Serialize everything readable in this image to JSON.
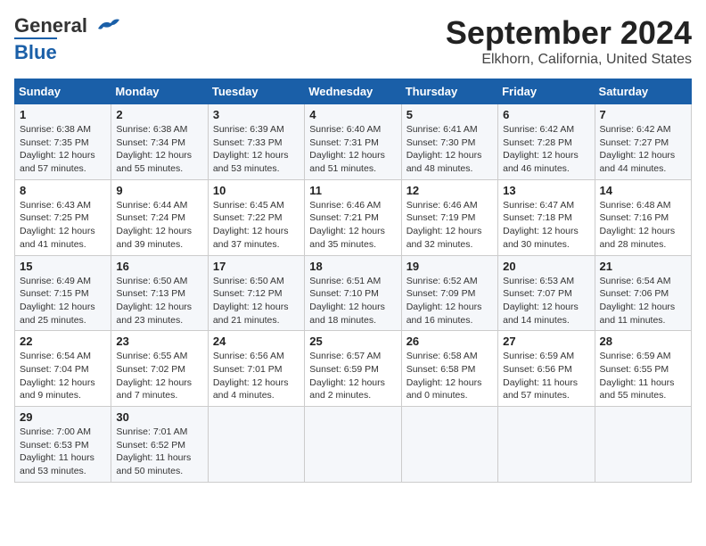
{
  "header": {
    "logo_line1": "General",
    "logo_line2": "Blue",
    "main_title": "September 2024",
    "subtitle": "Elkhorn, California, United States"
  },
  "weekdays": [
    "Sunday",
    "Monday",
    "Tuesday",
    "Wednesday",
    "Thursday",
    "Friday",
    "Saturday"
  ],
  "weeks": [
    [
      {
        "day": "1",
        "detail": "Sunrise: 6:38 AM\nSunset: 7:35 PM\nDaylight: 12 hours\nand 57 minutes."
      },
      {
        "day": "2",
        "detail": "Sunrise: 6:38 AM\nSunset: 7:34 PM\nDaylight: 12 hours\nand 55 minutes."
      },
      {
        "day": "3",
        "detail": "Sunrise: 6:39 AM\nSunset: 7:33 PM\nDaylight: 12 hours\nand 53 minutes."
      },
      {
        "day": "4",
        "detail": "Sunrise: 6:40 AM\nSunset: 7:31 PM\nDaylight: 12 hours\nand 51 minutes."
      },
      {
        "day": "5",
        "detail": "Sunrise: 6:41 AM\nSunset: 7:30 PM\nDaylight: 12 hours\nand 48 minutes."
      },
      {
        "day": "6",
        "detail": "Sunrise: 6:42 AM\nSunset: 7:28 PM\nDaylight: 12 hours\nand 46 minutes."
      },
      {
        "day": "7",
        "detail": "Sunrise: 6:42 AM\nSunset: 7:27 PM\nDaylight: 12 hours\nand 44 minutes."
      }
    ],
    [
      {
        "day": "8",
        "detail": "Sunrise: 6:43 AM\nSunset: 7:25 PM\nDaylight: 12 hours\nand 41 minutes."
      },
      {
        "day": "9",
        "detail": "Sunrise: 6:44 AM\nSunset: 7:24 PM\nDaylight: 12 hours\nand 39 minutes."
      },
      {
        "day": "10",
        "detail": "Sunrise: 6:45 AM\nSunset: 7:22 PM\nDaylight: 12 hours\nand 37 minutes."
      },
      {
        "day": "11",
        "detail": "Sunrise: 6:46 AM\nSunset: 7:21 PM\nDaylight: 12 hours\nand 35 minutes."
      },
      {
        "day": "12",
        "detail": "Sunrise: 6:46 AM\nSunset: 7:19 PM\nDaylight: 12 hours\nand 32 minutes."
      },
      {
        "day": "13",
        "detail": "Sunrise: 6:47 AM\nSunset: 7:18 PM\nDaylight: 12 hours\nand 30 minutes."
      },
      {
        "day": "14",
        "detail": "Sunrise: 6:48 AM\nSunset: 7:16 PM\nDaylight: 12 hours\nand 28 minutes."
      }
    ],
    [
      {
        "day": "15",
        "detail": "Sunrise: 6:49 AM\nSunset: 7:15 PM\nDaylight: 12 hours\nand 25 minutes."
      },
      {
        "day": "16",
        "detail": "Sunrise: 6:50 AM\nSunset: 7:13 PM\nDaylight: 12 hours\nand 23 minutes."
      },
      {
        "day": "17",
        "detail": "Sunrise: 6:50 AM\nSunset: 7:12 PM\nDaylight: 12 hours\nand 21 minutes."
      },
      {
        "day": "18",
        "detail": "Sunrise: 6:51 AM\nSunset: 7:10 PM\nDaylight: 12 hours\nand 18 minutes."
      },
      {
        "day": "19",
        "detail": "Sunrise: 6:52 AM\nSunset: 7:09 PM\nDaylight: 12 hours\nand 16 minutes."
      },
      {
        "day": "20",
        "detail": "Sunrise: 6:53 AM\nSunset: 7:07 PM\nDaylight: 12 hours\nand 14 minutes."
      },
      {
        "day": "21",
        "detail": "Sunrise: 6:54 AM\nSunset: 7:06 PM\nDaylight: 12 hours\nand 11 minutes."
      }
    ],
    [
      {
        "day": "22",
        "detail": "Sunrise: 6:54 AM\nSunset: 7:04 PM\nDaylight: 12 hours\nand 9 minutes."
      },
      {
        "day": "23",
        "detail": "Sunrise: 6:55 AM\nSunset: 7:02 PM\nDaylight: 12 hours\nand 7 minutes."
      },
      {
        "day": "24",
        "detail": "Sunrise: 6:56 AM\nSunset: 7:01 PM\nDaylight: 12 hours\nand 4 minutes."
      },
      {
        "day": "25",
        "detail": "Sunrise: 6:57 AM\nSunset: 6:59 PM\nDaylight: 12 hours\nand 2 minutes."
      },
      {
        "day": "26",
        "detail": "Sunrise: 6:58 AM\nSunset: 6:58 PM\nDaylight: 12 hours\nand 0 minutes."
      },
      {
        "day": "27",
        "detail": "Sunrise: 6:59 AM\nSunset: 6:56 PM\nDaylight: 11 hours\nand 57 minutes."
      },
      {
        "day": "28",
        "detail": "Sunrise: 6:59 AM\nSunset: 6:55 PM\nDaylight: 11 hours\nand 55 minutes."
      }
    ],
    [
      {
        "day": "29",
        "detail": "Sunrise: 7:00 AM\nSunset: 6:53 PM\nDaylight: 11 hours\nand 53 minutes."
      },
      {
        "day": "30",
        "detail": "Sunrise: 7:01 AM\nSunset: 6:52 PM\nDaylight: 11 hours\nand 50 minutes."
      },
      null,
      null,
      null,
      null,
      null
    ]
  ]
}
